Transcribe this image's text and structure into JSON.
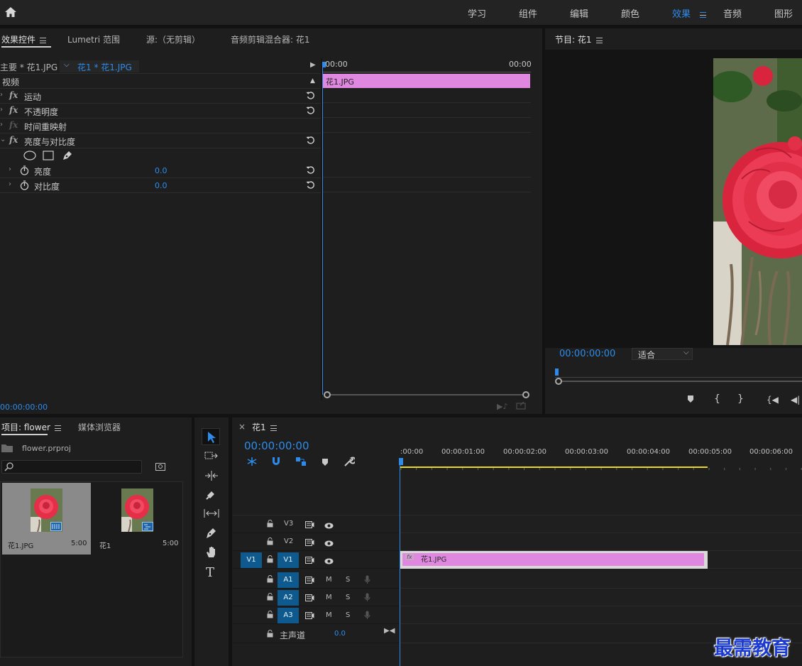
{
  "workspaces": [
    "学习",
    "组件",
    "编辑",
    "颜色",
    "效果",
    "音频",
    "图形"
  ],
  "effect_controls": {
    "tabs": {
      "effect_controls": "效果控件",
      "lumetri": "Lumetri 范围",
      "source": "源:（无剪辑）",
      "audio_mixer": "音频剪辑混合器: 花1"
    },
    "master_label": "主要 * 花1.JPG",
    "sequence_clip": "花1 * 花1.JPG",
    "time_start": "00:00",
    "time_end": "00:00",
    "clip_name": "花1.JPG",
    "section_video": "视频",
    "effects": [
      {
        "name": "运动",
        "reset": true
      },
      {
        "name": "不透明度",
        "reset": true
      },
      {
        "name": "时间重映射",
        "reset": false
      },
      {
        "name": "亮度与对比度",
        "reset": true
      }
    ],
    "params": [
      {
        "name": "亮度",
        "value": "0.0"
      },
      {
        "name": "对比度",
        "value": "0.0"
      }
    ],
    "timecode": "00:00:00:00"
  },
  "program": {
    "title": "节目: 花1",
    "timecode": "00:00:00:00",
    "fit_label": "适合"
  },
  "project": {
    "tab_project": "项目: flower",
    "tab_media": "媒体浏览器",
    "file": "flower.prproj",
    "items": [
      {
        "name": "花1.JPG",
        "duration": "5:00"
      },
      {
        "name": "花1",
        "duration": "5:00"
      }
    ]
  },
  "timeline": {
    "sequence": "花1",
    "close": "×",
    "timecode": "00:00:00:00",
    "ruler": [
      ":00:00",
      "00:00:01:00",
      "00:00:02:00",
      "00:00:03:00",
      "00:00:04:00",
      "00:00:05:00",
      "00:00:06:00"
    ],
    "video_tracks": [
      {
        "label": "V3",
        "target": "",
        "src": ""
      },
      {
        "label": "V2",
        "target": "",
        "src": ""
      },
      {
        "label": "V1",
        "target": "V1",
        "src": "V1"
      }
    ],
    "audio_tracks": [
      {
        "label": "A1",
        "m": "M",
        "s": "S"
      },
      {
        "label": "A2",
        "m": "M",
        "s": "S"
      },
      {
        "label": "A3",
        "m": "M",
        "s": "S"
      }
    ],
    "master_label": "主声道",
    "master_value": "0.0",
    "clip_name": "花1.JPG",
    "clip_fx": "fx"
  },
  "watermark": "最需教育",
  "colors": {
    "accent": "#2d8ceb",
    "clip": "#e088e0",
    "track_button": "#0e5a8e"
  }
}
